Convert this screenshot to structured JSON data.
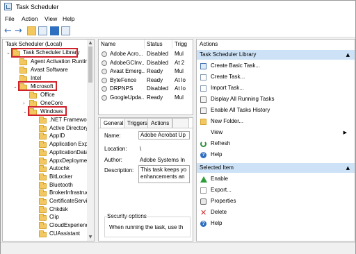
{
  "window": {
    "title": "Task Scheduler"
  },
  "menu": [
    "File",
    "Action",
    "View",
    "Help"
  ],
  "tree": {
    "root": "Task Scheduler (Local)",
    "library": "Task Scheduler Library",
    "top_items": [
      "Agent Activation Runtime",
      "Avast Software",
      "Intel"
    ],
    "microsoft": "Microsoft",
    "ms_items": [
      "Office",
      "OneCore"
    ],
    "windows": "Windows",
    "win_items": [
      ".NET Framework",
      "Active Directory",
      "AppID",
      "Application Experience",
      "ApplicationData",
      "AppxDeploymentClient",
      "Autochk",
      "BitLocker",
      "Bluetooth",
      "BrokerInfrastructure",
      "CertificateServicesClient",
      "Chkdsk",
      "Clip",
      "CloudExperienceHost",
      "CUAssistant"
    ]
  },
  "tasks": {
    "columns": [
      "Name",
      "Status",
      "Trigg"
    ],
    "rows": [
      {
        "name": "Adobe Acro...",
        "status": "Disabled",
        "trigger": "Mul"
      },
      {
        "name": "AdobeGCInv...",
        "status": "Disabled",
        "trigger": "At 2"
      },
      {
        "name": "Avast Emerg...",
        "status": "Ready",
        "trigger": "Mul"
      },
      {
        "name": "ByteFence",
        "status": "Ready",
        "trigger": "At lo"
      },
      {
        "name": "DRPNPS",
        "status": "Disabled",
        "trigger": "At lo"
      },
      {
        "name": "GoogleUpda...",
        "status": "Ready",
        "trigger": "Mul"
      }
    ]
  },
  "details": {
    "tabs": [
      "General",
      "Triggers",
      "Actions"
    ],
    "name_label": "Name:",
    "name_value": "Adobe Acrobat Up",
    "location_label": "Location:",
    "location_value": "\\",
    "author_label": "Author:",
    "author_value": "Adobe Systems In",
    "description_label": "Description:",
    "description_value": "This task keeps yo enhancements an",
    "security_label": "Security options",
    "security_text": "When running the task, use th"
  },
  "actions": {
    "title": "Actions",
    "library_section": "Task Scheduler Library",
    "library_items": [
      "Create Basic Task...",
      "Create Task...",
      "Import Task...",
      "Display All Running Tasks",
      "Enable All Tasks History",
      "New Folder...",
      "View",
      "Refresh",
      "Help"
    ],
    "selected_section": "Selected Item",
    "selected_items": [
      "Enable",
      "Export...",
      "Properties",
      "Delete",
      "Help"
    ]
  }
}
